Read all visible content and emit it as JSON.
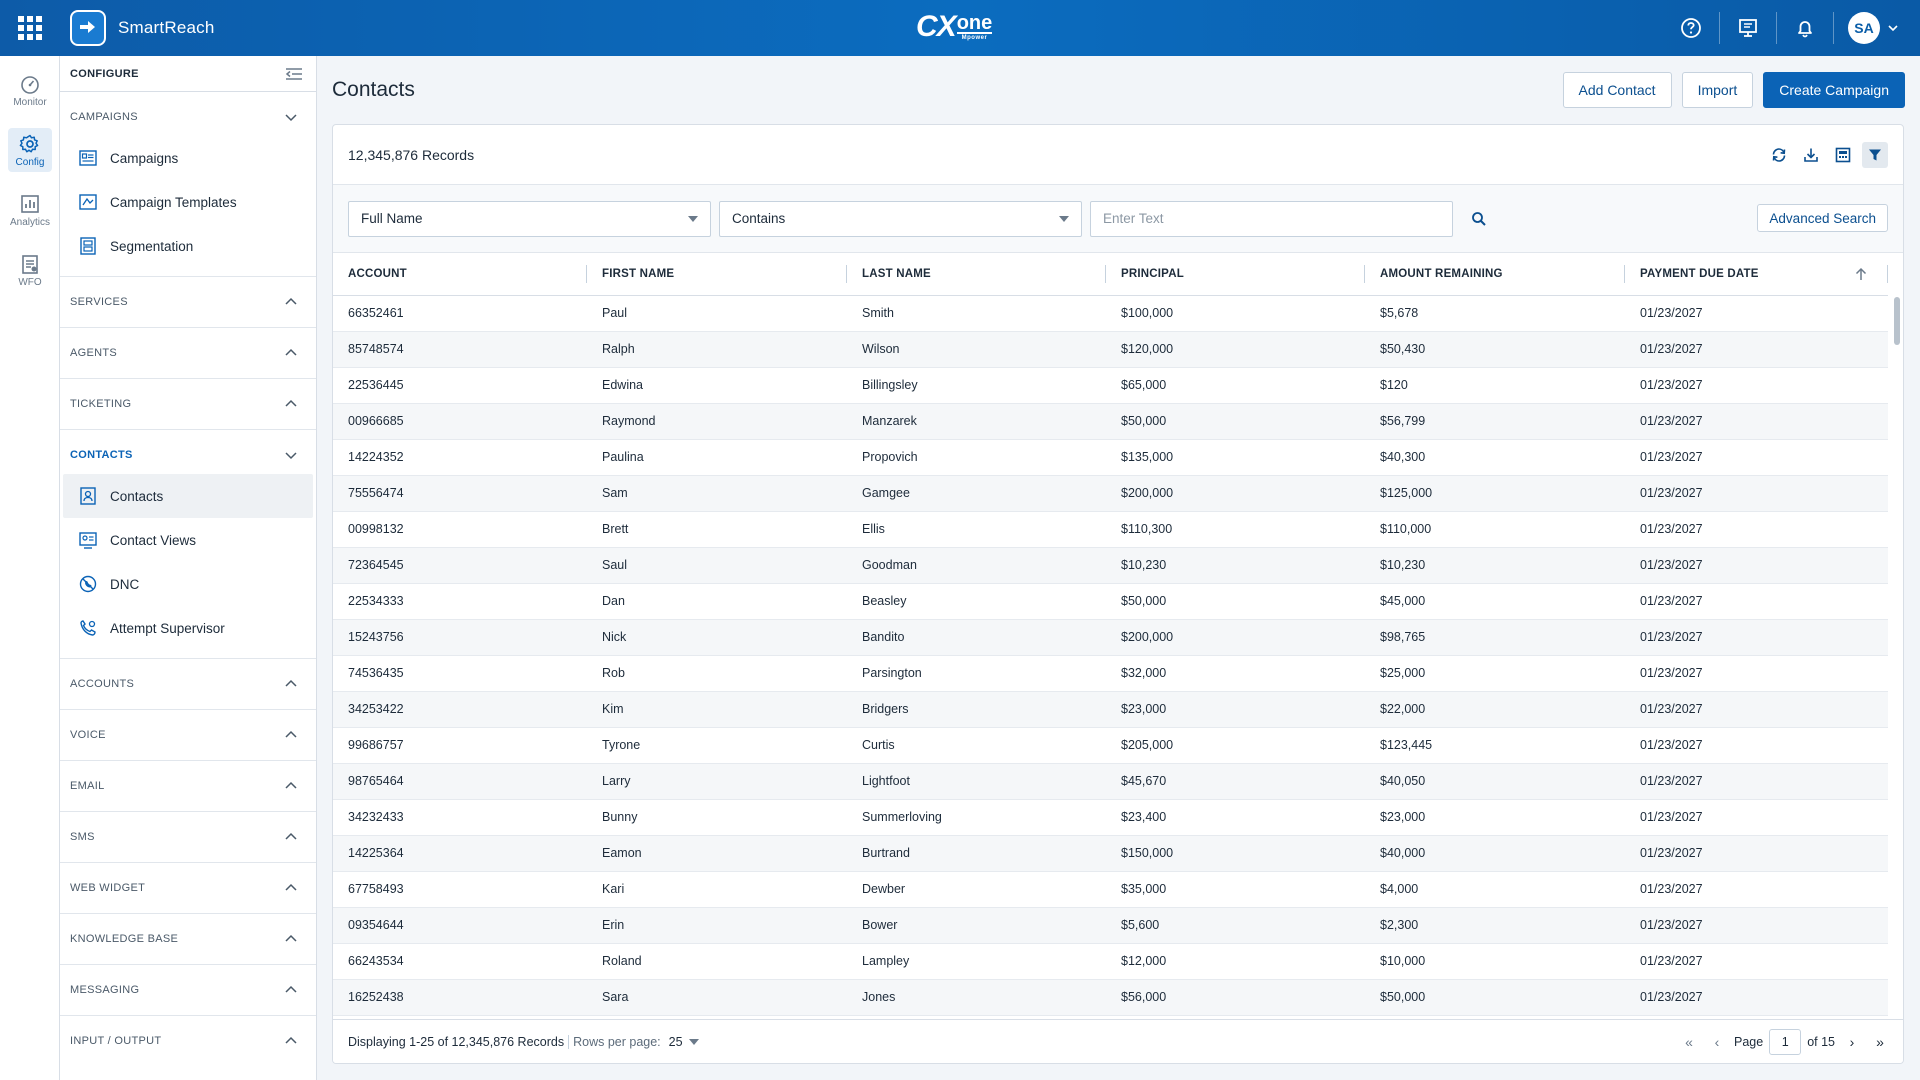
{
  "topbar": {
    "app_name": "SmartReach",
    "logo_main": "CX",
    "logo_sub": "one",
    "logo_tag": "Mpower",
    "avatar_initials": "SA"
  },
  "rail": [
    {
      "label": "Monitor",
      "icon": "speedometer-icon"
    },
    {
      "label": "Config",
      "icon": "gear-icon"
    },
    {
      "label": "Analytics",
      "icon": "bar-chart-icon"
    },
    {
      "label": "WFO",
      "icon": "clipboard-icon"
    }
  ],
  "sidebar": {
    "title": "CONFIGURE",
    "campaigns": {
      "label": "CAMPAIGNS",
      "items": [
        "Campaigns",
        "Campaign Templates",
        "Segmentation"
      ]
    },
    "services": "SERVICES",
    "agents": "AGENTS",
    "ticketing": "TICKETING",
    "contacts": {
      "label": "CONTACTS",
      "items": [
        "Contacts",
        "Contact Views",
        "DNC",
        "Attempt Supervisor"
      ]
    },
    "accounts": "ACCOUNTS",
    "voice": "VOICE",
    "email": "EMAIL",
    "sms": "SMS",
    "web_widget": "WEB WIDGET",
    "knowledge_base": "KNOWLEDGE BASE",
    "messaging": "MESSAGING",
    "input_output": "INPUT / OUTPUT"
  },
  "main": {
    "title": "Contacts",
    "actions": {
      "add_contact": "Add Contact",
      "import": "Import",
      "create_campaign": "Create Campaign"
    },
    "records": "12,345,876 Records",
    "filter": {
      "field": "Full Name",
      "operator": "Contains",
      "placeholder": "Enter Text",
      "advanced": "Advanced Search"
    },
    "columns": [
      "ACCOUNT",
      "FIRST NAME",
      "LAST NAME",
      "PRINCIPAL",
      "AMOUNT REMAINING",
      "PAYMENT DUE DATE"
    ],
    "rows": [
      [
        "66352461",
        "Paul",
        "Smith",
        "$100,000",
        "$5,678",
        "01/23/2027"
      ],
      [
        "85748574",
        "Ralph",
        "Wilson",
        "$120,000",
        "$50,430",
        "01/23/2027"
      ],
      [
        "22536445",
        "Edwina",
        "Billingsley",
        "$65,000",
        "$120",
        "01/23/2027"
      ],
      [
        "00966685",
        "Raymond",
        "Manzarek",
        "$50,000",
        "$56,799",
        "01/23/2027"
      ],
      [
        "14224352",
        "Paulina",
        "Propovich",
        "$135,000",
        "$40,300",
        "01/23/2027"
      ],
      [
        "75556474",
        "Sam",
        "Gamgee",
        "$200,000",
        "$125,000",
        "01/23/2027"
      ],
      [
        "00998132",
        "Brett",
        "Ellis",
        "$110,300",
        "$110,000",
        "01/23/2027"
      ],
      [
        "72364545",
        "Saul",
        "Goodman",
        "$10,230",
        "$10,230",
        "01/23/2027"
      ],
      [
        "22534333",
        "Dan",
        "Beasley",
        "$50,000",
        "$45,000",
        "01/23/2027"
      ],
      [
        "15243756",
        "Nick",
        "Bandito",
        "$200,000",
        "$98,765",
        "01/23/2027"
      ],
      [
        "74536435",
        "Rob",
        "Parsington",
        "$32,000",
        "$25,000",
        "01/23/2027"
      ],
      [
        "34253422",
        "Kim",
        "Bridgers",
        "$23,000",
        "$22,000",
        "01/23/2027"
      ],
      [
        "99686757",
        "Tyrone",
        "Curtis",
        "$205,000",
        "$123,445",
        "01/23/2027"
      ],
      [
        "98765464",
        "Larry",
        "Lightfoot",
        "$45,670",
        "$40,050",
        "01/23/2027"
      ],
      [
        "34232433",
        "Bunny",
        "Summerloving",
        "$23,400",
        "$23,000",
        "01/23/2027"
      ],
      [
        "14225364",
        "Eamon",
        "Burtrand",
        "$150,000",
        "$40,000",
        "01/23/2027"
      ],
      [
        "67758493",
        "Kari",
        "Dewber",
        "$35,000",
        "$4,000",
        "01/23/2027"
      ],
      [
        "09354644",
        "Erin",
        "Bower",
        "$5,600",
        "$2,300",
        "01/23/2027"
      ],
      [
        "66243534",
        "Roland",
        "Lampley",
        "$12,000",
        "$10,000",
        "01/23/2027"
      ],
      [
        "16252438",
        "Sara",
        "Jones",
        "$56,000",
        "$50,000",
        "01/23/2027"
      ]
    ],
    "footer": {
      "displaying": "Displaying 1-25 of 12,345,876 Records",
      "rows_per_page_label": "Rows per page:",
      "rows_per_page": "25",
      "page_label": "Page",
      "page_value": "1",
      "of_pages": "of 15"
    }
  },
  "colors": {
    "brand": "#0b63b6",
    "topbar": "#0b6cbf"
  }
}
